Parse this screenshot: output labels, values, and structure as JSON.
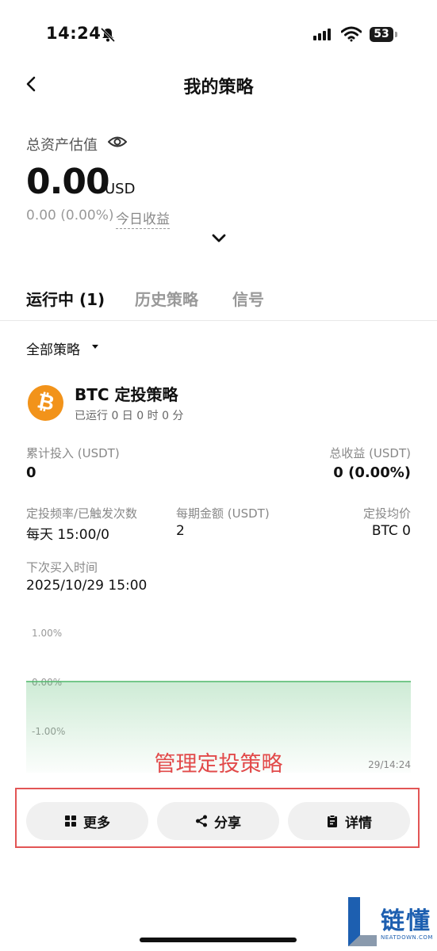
{
  "status_bar": {
    "time": "14:24",
    "battery": "53"
  },
  "header": {
    "title": "我的策略"
  },
  "assets": {
    "label": "总资产估值",
    "value": "0.00",
    "unit": "USD",
    "change": "0.00 (0.00%)",
    "today_label": "今日收益"
  },
  "tabs": [
    {
      "label": "运行中 (1)"
    },
    {
      "label": "历史策略"
    },
    {
      "label": "信号"
    }
  ],
  "filter": {
    "label": "全部策略"
  },
  "strategy": {
    "name": "BTC 定投策略",
    "running": "已运行 0 日 0 时 0 分",
    "invested_label": "累计投入 (USDT)",
    "invested_value": "0",
    "profit_label": "总收益 (USDT)",
    "profit_value": "0 (0.00%)",
    "freq_label": "定投频率/已触发次数",
    "freq_value": "每天 15:00/0",
    "amount_label": "每期金额 (USDT)",
    "amount_value": "2",
    "avg_label": "定投均价",
    "avg_value": "BTC 0",
    "next_label": "下次买入时间",
    "next_value": "2025/10/29 15:00"
  },
  "chart_data": {
    "type": "area",
    "y_ticks": [
      "1.00%",
      "0.00%",
      "-1.00%"
    ],
    "ylim": [
      -1,
      1
    ],
    "x_label": "29/14:24",
    "values": [
      0,
      0
    ],
    "line_color": "#4fb86a"
  },
  "overlay_text": "管理定投策略",
  "actions": {
    "more": "更多",
    "share": "分享",
    "details": "详情"
  },
  "watermark": {
    "cn": "链懂",
    "en": "NEATDOWN.COM"
  }
}
